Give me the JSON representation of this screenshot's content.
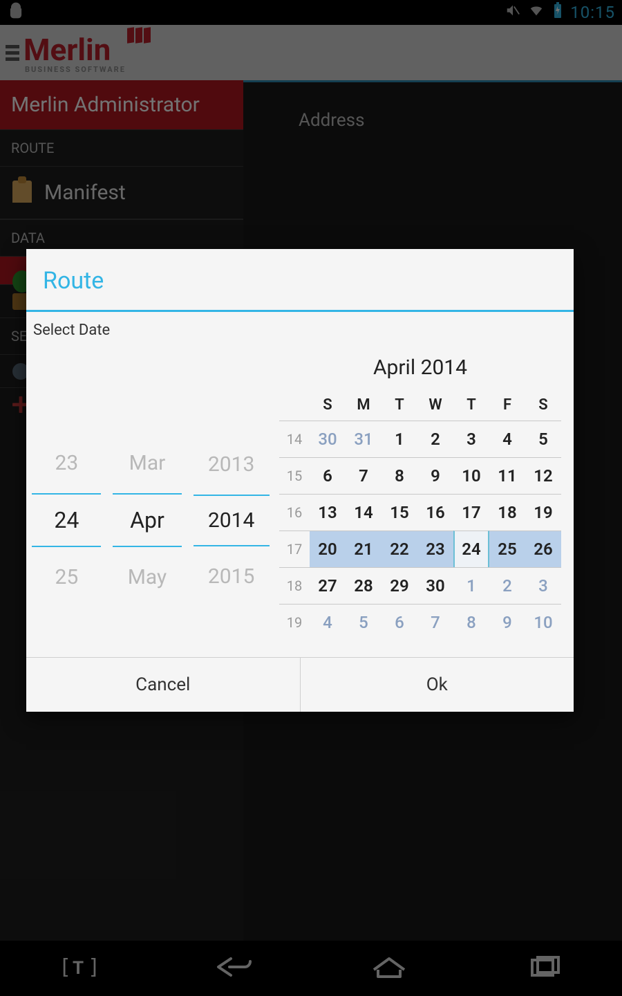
{
  "status": {
    "time": "10:15"
  },
  "brand": {
    "name": "Merlin",
    "tag": "BUSINESS SOFTWARE"
  },
  "sidebar": {
    "title": "Merlin Administrator",
    "sections": {
      "route_label": "ROUTE",
      "data_label": "DATA",
      "se_label": "SE"
    },
    "manifest": "Manifest"
  },
  "main": {
    "address_label": "Address"
  },
  "dialog": {
    "title": "Route",
    "subtitle": "Select Date",
    "picker": {
      "day": {
        "prev": "23",
        "sel": "24",
        "next": "25"
      },
      "month": {
        "prev": "Mar",
        "sel": "Apr",
        "next": "May"
      },
      "year": {
        "prev": "2013",
        "sel": "2014",
        "next": "2015"
      }
    },
    "calendar": {
      "title": "April 2014",
      "weekdays": [
        "S",
        "M",
        "T",
        "W",
        "T",
        "F",
        "S"
      ],
      "weeks": [
        {
          "wk": "14",
          "days": [
            {
              "n": "30",
              "dim": true
            },
            {
              "n": "31",
              "dim": true
            },
            {
              "n": "1"
            },
            {
              "n": "2"
            },
            {
              "n": "3"
            },
            {
              "n": "4"
            },
            {
              "n": "5"
            }
          ]
        },
        {
          "wk": "15",
          "days": [
            {
              "n": "6"
            },
            {
              "n": "7"
            },
            {
              "n": "8"
            },
            {
              "n": "9"
            },
            {
              "n": "10"
            },
            {
              "n": "11"
            },
            {
              "n": "12"
            }
          ]
        },
        {
          "wk": "16",
          "days": [
            {
              "n": "13"
            },
            {
              "n": "14"
            },
            {
              "n": "15"
            },
            {
              "n": "16"
            },
            {
              "n": "17"
            },
            {
              "n": "18"
            },
            {
              "n": "19"
            }
          ]
        },
        {
          "wk": "17",
          "days": [
            {
              "n": "20",
              "hl": true
            },
            {
              "n": "21",
              "hl": true
            },
            {
              "n": "22",
              "hl": true
            },
            {
              "n": "23",
              "hl": true
            },
            {
              "n": "24",
              "today": true
            },
            {
              "n": "25",
              "hl": true
            },
            {
              "n": "26",
              "hl": true
            }
          ]
        },
        {
          "wk": "18",
          "days": [
            {
              "n": "27"
            },
            {
              "n": "28"
            },
            {
              "n": "29"
            },
            {
              "n": "30"
            },
            {
              "n": "1",
              "dim": true
            },
            {
              "n": "2",
              "dim": true
            },
            {
              "n": "3",
              "dim": true
            }
          ]
        },
        {
          "wk": "19",
          "days": [
            {
              "n": "4",
              "dim": true
            },
            {
              "n": "5",
              "dim": true
            },
            {
              "n": "6",
              "dim": true
            },
            {
              "n": "7",
              "dim": true
            },
            {
              "n": "8",
              "dim": true
            },
            {
              "n": "9",
              "dim": true
            },
            {
              "n": "10",
              "dim": true
            }
          ]
        }
      ]
    },
    "actions": {
      "cancel": "Cancel",
      "ok": "Ok"
    }
  }
}
